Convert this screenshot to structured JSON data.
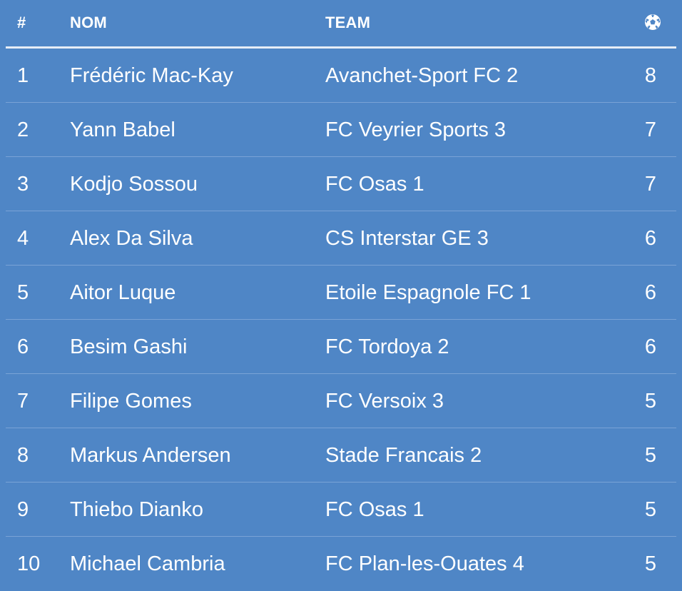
{
  "table": {
    "headers": {
      "rank": "#",
      "name": "NOM",
      "team": "TEAM",
      "goals_icon": "soccer-ball-icon"
    },
    "rows": [
      {
        "rank": "1",
        "name": "Frédéric Mac-Kay",
        "team": "Avanchet-Sport FC 2",
        "goals": "8"
      },
      {
        "rank": "2",
        "name": "Yann Babel",
        "team": "FC Veyrier Sports 3",
        "goals": "7"
      },
      {
        "rank": "3",
        "name": "Kodjo Sossou",
        "team": "FC Osas 1",
        "goals": "7"
      },
      {
        "rank": "4",
        "name": "Alex Da Silva",
        "team": "CS Interstar GE 3",
        "goals": "6"
      },
      {
        "rank": "5",
        "name": "Aitor Luque",
        "team": "Etoile Espagnole FC 1",
        "goals": "6"
      },
      {
        "rank": "6",
        "name": "Besim Gashi",
        "team": "FC Tordoya 2",
        "goals": "6"
      },
      {
        "rank": "7",
        "name": "Filipe Gomes",
        "team": "FC Versoix 3",
        "goals": "5"
      },
      {
        "rank": "8",
        "name": "Markus Andersen",
        "team": "Stade Francais 2",
        "goals": "5"
      },
      {
        "rank": "9",
        "name": "Thiebo Dianko",
        "team": "FC Osas 1",
        "goals": "5"
      },
      {
        "rank": "10",
        "name": "Michael Cambria",
        "team": "FC Plan-les-Ouates 4",
        "goals": "5"
      }
    ]
  },
  "colors": {
    "background": "#4f86c6",
    "text": "#ffffff",
    "row_divider": "#7aa3d6",
    "header_divider": "#e6edf6"
  }
}
